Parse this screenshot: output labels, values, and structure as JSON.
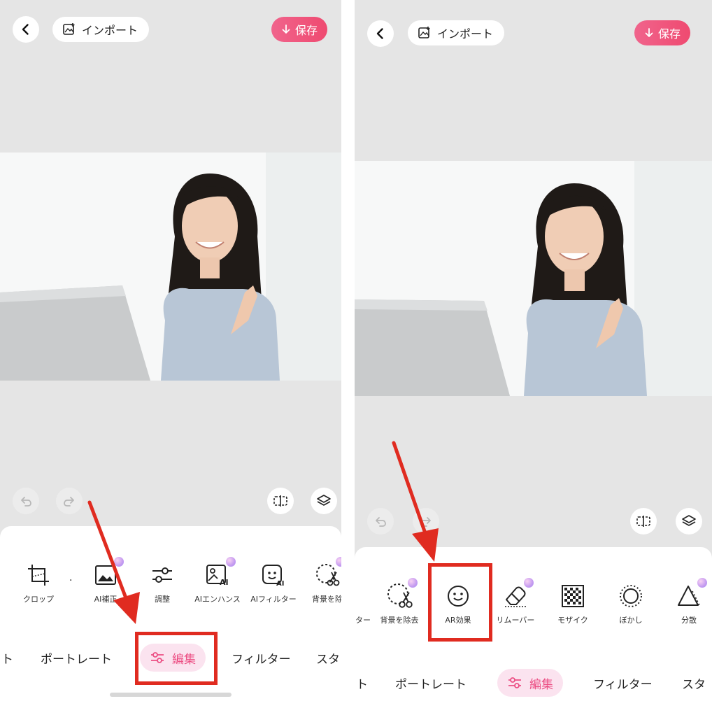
{
  "header": {
    "import_label": "インポート",
    "save_label": "保存"
  },
  "tools": {
    "crop": "クロップ",
    "ai_correct": "AI補正",
    "adjust": "調整",
    "ai_enhance": "AIエンハンス",
    "ai_filter": "AIフィルター",
    "bg_remove_partial": "背景を除",
    "left_cut": "ター",
    "bg_remove": "背景を除去",
    "ar_effect": "AR効果",
    "remover": "リムーバー",
    "mosaic": "モザイク",
    "blur": "ぼかし",
    "scatter": "分散"
  },
  "tabs": {
    "left_cut": "ト",
    "portrait": "ポートレート",
    "edit": "編集",
    "filter": "フィルター",
    "right_cut": "スタ"
  },
  "colors": {
    "accent": "#ec4f84",
    "highlight": "#e02b20",
    "save": "#ef4a70"
  }
}
